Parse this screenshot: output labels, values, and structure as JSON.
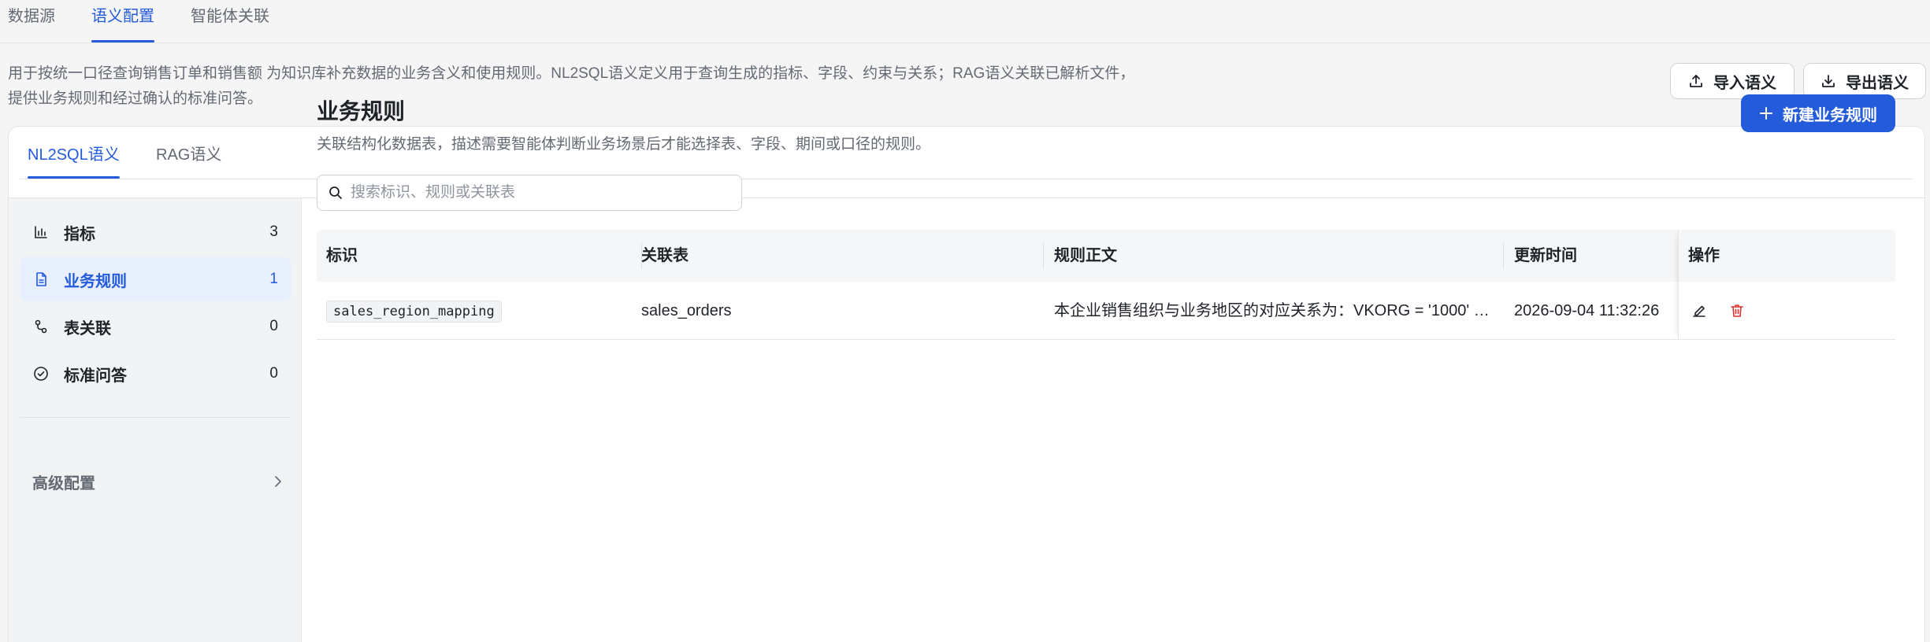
{
  "top_tabs": [
    {
      "label": "数据源"
    },
    {
      "label": "语义配置"
    },
    {
      "label": "智能体关联"
    }
  ],
  "description": "用于按统一口径查询销售订单和销售额 为知识库补充数据的业务含义和使用规则。NL2SQL语义定义用于查询生成的指标、字段、约束与关系；RAG语义关联已解析文件，提供业务规则和经过确认的标准问答。",
  "header_buttons": {
    "import_label": "导入语义",
    "export_label": "导出语义"
  },
  "sub_tabs": [
    {
      "label": "NL2SQL语义"
    },
    {
      "label": "RAG语义"
    }
  ],
  "sidebar": {
    "items": [
      {
        "label": "指标",
        "count": "3",
        "icon": "bar-chart-icon"
      },
      {
        "label": "业务规则",
        "count": "1",
        "icon": "document-icon"
      },
      {
        "label": "表关联",
        "count": "0",
        "icon": "link-icon"
      },
      {
        "label": "标准问答",
        "count": "0",
        "icon": "check-circle-icon"
      }
    ],
    "advanced_label": "高级配置"
  },
  "main": {
    "title": "业务规则",
    "subtitle": "关联结构化数据表，描述需要智能体判断业务场景后才能选择表、字段、期间或口径的规则。",
    "new_button_label": "新建业务规则",
    "search_placeholder": "搜索标识、规则或关联表"
  },
  "table": {
    "headers": [
      "标识",
      "关联表",
      "规则正文",
      "更新时间",
      "操作"
    ],
    "rows": [
      {
        "id": "sales_region_mapping",
        "table": "sales_orders",
        "rule": "本企业销售组织与业务地区的对应关系为：VKORG = '1000' …",
        "updated": "2026-09-04 11:32:26"
      }
    ]
  },
  "colors": {
    "accent": "#245bdb",
    "delete": "#e0332e"
  }
}
